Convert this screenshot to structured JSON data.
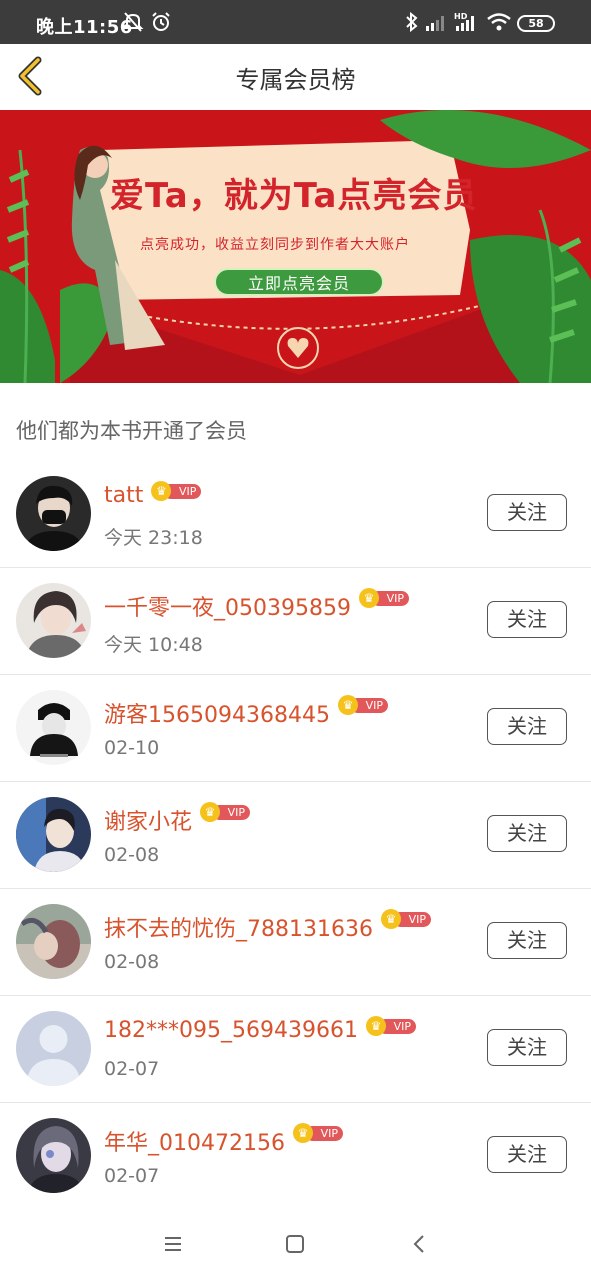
{
  "status_bar": {
    "time": "晚上11:56",
    "battery": "58"
  },
  "header": {
    "title": "专属会员榜"
  },
  "banner": {
    "title": "爱Ta，就为Ta点亮会员",
    "subtitle": "点亮成功，收益立刻同步到作者大大账户",
    "button": "立即点亮会员"
  },
  "section": {
    "title": "他们都为本书开通了会员"
  },
  "members": [
    {
      "name": "tatt",
      "time": "今天 23:18",
      "vip": "VIP",
      "follow": "关注"
    },
    {
      "name": "一千零一夜_050395859",
      "time": "今天 10:48",
      "vip": "VIP",
      "follow": "关注"
    },
    {
      "name": "游客1565094368445",
      "time": "02-10",
      "vip": "VIP",
      "follow": "关注"
    },
    {
      "name": "谢家小花",
      "time": "02-08",
      "vip": "VIP",
      "follow": "关注"
    },
    {
      "name": "抹不去的忧伤_788131636",
      "time": "02-08",
      "vip": "VIP",
      "follow": "关注"
    },
    {
      "name": "182***095_569439661",
      "time": "02-07",
      "vip": "VIP",
      "follow": "关注"
    },
    {
      "name": "年华_010472156",
      "time": "02-07",
      "vip": "VIP",
      "follow": "关注"
    }
  ],
  "colors": {
    "username": "#d7532e",
    "vip_badge": "#e2585a",
    "banner_red": "#c9151a",
    "banner_button": "#3d9a3e",
    "back_arrow": "#f2c12e"
  }
}
